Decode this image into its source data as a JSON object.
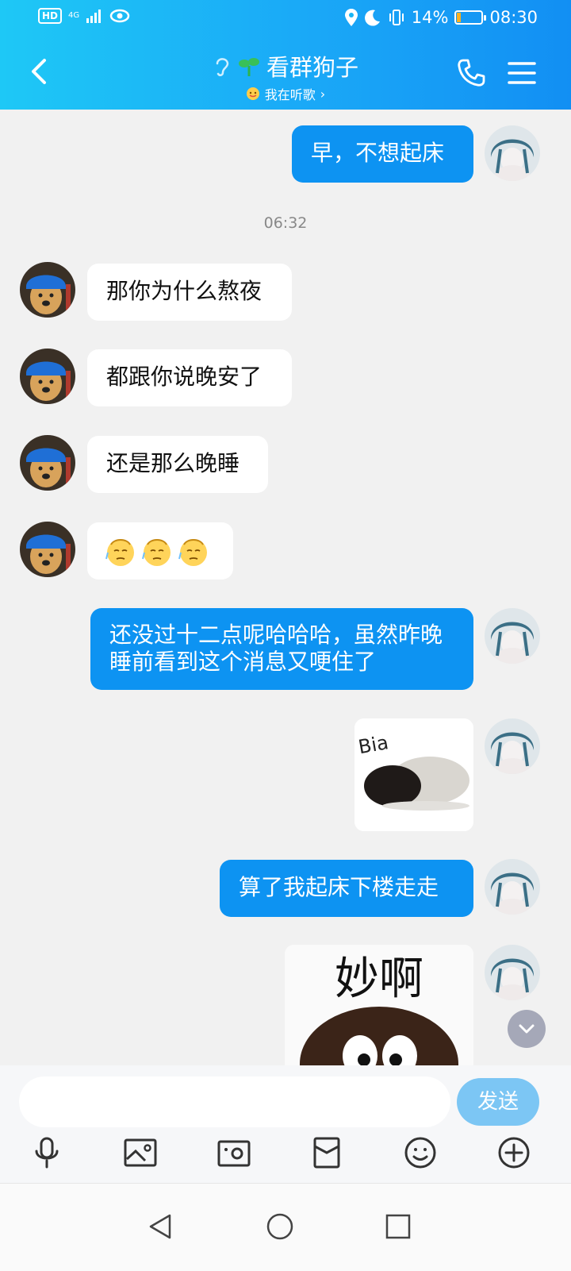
{
  "status_bar": {
    "hd_label": "HD",
    "network_label": "4G",
    "battery_percent": "14%",
    "battery_level": 0.14,
    "time": "08:30"
  },
  "header": {
    "title": "看群狗子",
    "subtitle": "我在听歌",
    "subtitle_chevron": "›"
  },
  "messages": [
    {
      "direction": "out",
      "text": "早，不想起床"
    },
    {
      "direction": "in",
      "text": "那你为什么熬夜"
    },
    {
      "direction": "in",
      "text": "都跟你说晚安了"
    },
    {
      "direction": "in",
      "text": "还是那么晚睡"
    },
    {
      "direction": "in",
      "text": "😓😓😓"
    },
    {
      "direction": "out",
      "text": "还没过十二点呢哈哈哈，虽然昨晚睡前看到这个消息又哽住了"
    },
    {
      "direction": "out",
      "sticker_text": "Bia"
    },
    {
      "direction": "out",
      "text": "算了我起床下楼走走"
    },
    {
      "direction": "out",
      "sticker_text": "妙啊"
    }
  ],
  "timestamp": "06:32",
  "input": {
    "placeholder": "",
    "value": "",
    "send_label": "发送"
  },
  "toolbar_icons": [
    "microphone-icon",
    "image-icon",
    "camera-icon",
    "red-packet-icon",
    "emoji-icon",
    "plus-icon"
  ],
  "colors": {
    "header_gradient_start": "#1ec8f6",
    "header_gradient_end": "#128ff3",
    "outgoing_bubble": "#0d93f2",
    "incoming_bubble": "#ffffff",
    "send_button": "#7cc6f4",
    "background": "#f1f1f1"
  }
}
